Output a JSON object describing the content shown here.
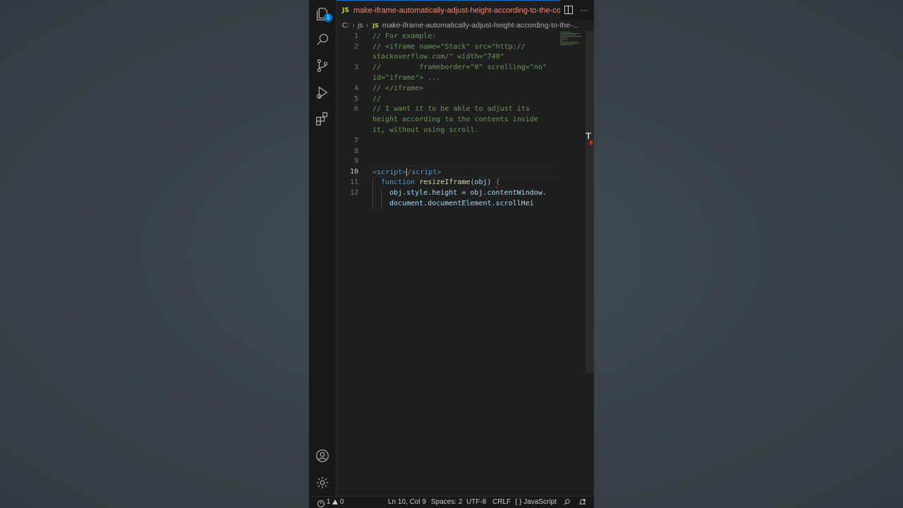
{
  "tab": {
    "language_badge": "JS",
    "title": "make-iframe-automatically-adjust-height-according-to-the-conte",
    "more": "···"
  },
  "breadcrumb": {
    "drive": "C:",
    "folder": "js",
    "language_badge": "JS",
    "file": "make-iframe-automatically-adjust-height-according-to-the-..."
  },
  "activity": {
    "explorer_badge": "1"
  },
  "editor": {
    "line_numbers": [
      "1",
      "2",
      "3",
      "4",
      "5",
      "6",
      "7",
      "8",
      "9",
      "10",
      "11",
      "12"
    ],
    "comment_lines": [
      "// For example:",
      "// <iframe name=\"Stack\" src=\"http://",
      "stackoverflow.com/\" width=\"740\"",
      "//         frameborder=\"0\" scrolling=\"no\"",
      "id=\"iframe\"> ...",
      "// </iframe>",
      "//",
      "// I want it to be able to adjust its",
      "height according to the contents inside",
      "it, without using scroll."
    ],
    "line10": {
      "open_lt": "<",
      "open_tag": "script",
      "open_gt": ">",
      "close_lt": "/",
      "close_tag": "script",
      "close_gt": ">"
    },
    "line11": {
      "keyword": "function",
      "name": "resizeIframe",
      "params": "(obj)",
      "brace": "{"
    },
    "line12a": "obj.style.height = obj.contentWindow.",
    "line12b": "document.documentElement.scrollHei"
  },
  "scroll_marker": "T",
  "status": {
    "errors": "1",
    "warnings": "0",
    "position": "Ln 10, Col 9",
    "spaces": "Spaces: 2",
    "encoding": "UTF-8",
    "eol": "CRLF",
    "language_icon": "{ }",
    "language": "JavaScript"
  },
  "colors": {
    "accent": "#0078d4",
    "tab_title": "#f48771",
    "comment": "#6a9955",
    "keyword": "#569cd6",
    "function": "#dcdcaa"
  }
}
